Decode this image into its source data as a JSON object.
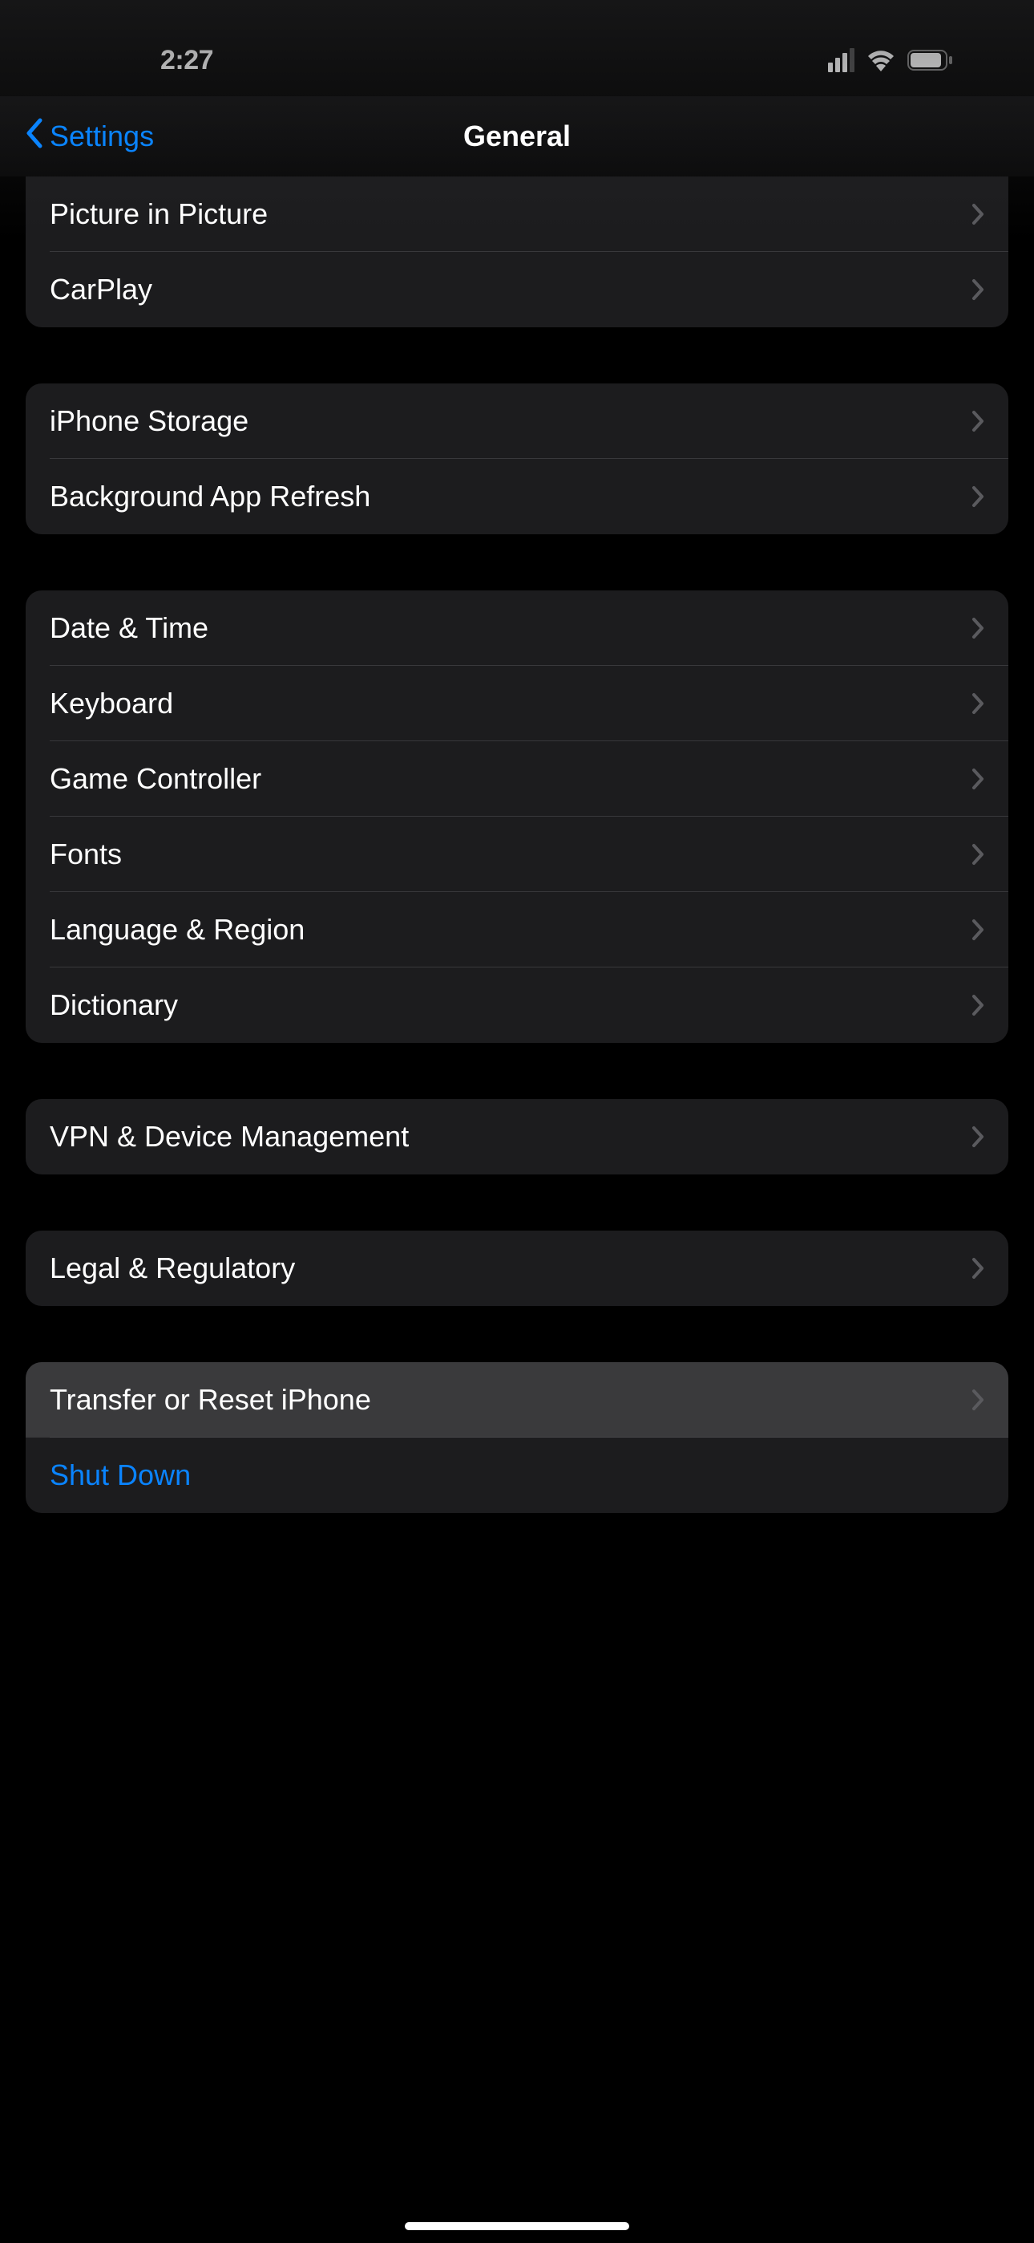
{
  "status": {
    "time": "2:27"
  },
  "nav": {
    "back_label": "Settings",
    "title": "General"
  },
  "groups": [
    {
      "rows": [
        {
          "label": "Picture in Picture",
          "chevron": true
        },
        {
          "label": "CarPlay",
          "chevron": true
        }
      ]
    },
    {
      "rows": [
        {
          "label": "iPhone Storage",
          "chevron": true
        },
        {
          "label": "Background App Refresh",
          "chevron": true
        }
      ]
    },
    {
      "rows": [
        {
          "label": "Date & Time",
          "chevron": true
        },
        {
          "label": "Keyboard",
          "chevron": true
        },
        {
          "label": "Game Controller",
          "chevron": true
        },
        {
          "label": "Fonts",
          "chevron": true
        },
        {
          "label": "Language & Region",
          "chevron": true
        },
        {
          "label": "Dictionary",
          "chevron": true
        }
      ]
    },
    {
      "rows": [
        {
          "label": "VPN & Device Management",
          "chevron": true
        }
      ]
    },
    {
      "rows": [
        {
          "label": "Legal & Regulatory",
          "chevron": true
        }
      ]
    },
    {
      "rows": [
        {
          "label": "Transfer or Reset iPhone",
          "chevron": true,
          "highlighted": true
        },
        {
          "label": "Shut Down",
          "chevron": false,
          "link": true
        }
      ]
    }
  ]
}
